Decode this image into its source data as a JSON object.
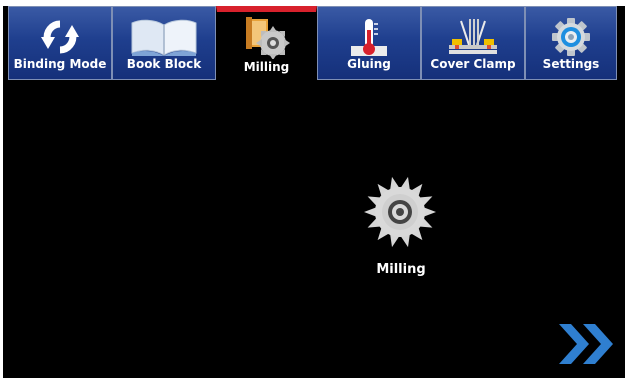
{
  "tabs": [
    {
      "label": "Binding Mode",
      "icon": "refresh-icon",
      "active": false
    },
    {
      "label": "Book Block",
      "icon": "open-book-icon",
      "active": false
    },
    {
      "label": "Milling",
      "icon": "milling-cutter-icon",
      "active": true
    },
    {
      "label": "Gluing",
      "icon": "thermometer-icon",
      "active": false
    },
    {
      "label": "Cover Clamp",
      "icon": "clamp-icon",
      "active": false
    },
    {
      "label": "Settings",
      "icon": "gear-icon",
      "active": false
    }
  ],
  "main": {
    "title": "Milling",
    "icon": "saw-blade-icon"
  },
  "navigation": {
    "next_icon": "double-chevron-right-icon"
  },
  "colors": {
    "tab_bg": "#1f3f8e",
    "tab_border": "#7e8fb5",
    "active_indicator": "#d8212c",
    "screen_bg": "#000000",
    "accent_arrow": "#2f7fd0"
  }
}
